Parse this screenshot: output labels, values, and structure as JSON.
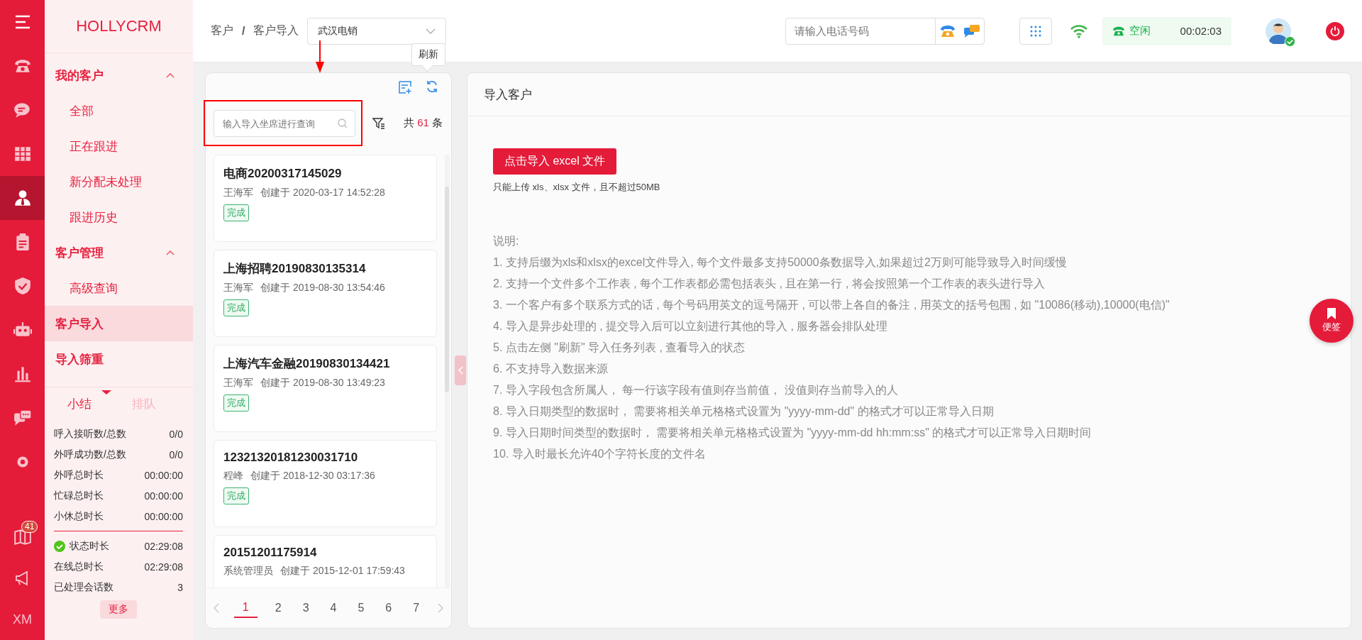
{
  "rail": {
    "items": [
      {
        "selected": false
      },
      {
        "selected": false
      },
      {
        "selected": false
      },
      {
        "selected": true
      },
      {
        "selected": false
      },
      {
        "selected": false
      },
      {
        "selected": false
      },
      {
        "selected": false
      },
      {
        "selected": false
      },
      {
        "selected": false
      }
    ],
    "book_badge": "41",
    "user_initials": "XM"
  },
  "sidebar": {
    "logo": "HOLLYCRM",
    "items": [
      {
        "label": "我的客户",
        "expanded": true,
        "children": [
          {
            "label": "全部",
            "selected": false
          },
          {
            "label": "正在跟进",
            "selected": false
          },
          {
            "label": "新分配未处理",
            "selected": false
          },
          {
            "label": "跟进历史",
            "selected": false
          }
        ]
      },
      {
        "label": "客户管理",
        "expanded": true,
        "children": [
          {
            "label": "高级查询",
            "selected": false
          }
        ]
      },
      {
        "label": "客户导入",
        "selected": true
      },
      {
        "label": "导入筛重",
        "selected": false
      }
    ],
    "summary": {
      "tabs": [
        {
          "label": "小结",
          "selected": true
        },
        {
          "label": "排队",
          "selected": false
        }
      ],
      "rows": [
        {
          "label": "呼入接听数/总数",
          "value": "0/0"
        },
        {
          "label": "外呼成功数/总数",
          "value": "0/0"
        },
        {
          "label": "外呼总时长",
          "value": "00:00:00"
        },
        {
          "label": "忙碌总时长",
          "value": "00:00:00"
        },
        {
          "label": "小休总时长",
          "value": "00:00:00"
        }
      ],
      "rows2": [
        {
          "label": "状态时长",
          "value": "02:29:08",
          "ok": true
        },
        {
          "label": "在线总时长",
          "value": "02:29:08",
          "ok": false
        },
        {
          "label": "已处理会话数",
          "value": "3",
          "ok": false
        }
      ],
      "more": "更多"
    }
  },
  "header": {
    "breadcrumb": [
      "客户",
      "客户导入"
    ],
    "separator": "/",
    "dropdown": "武汉电销",
    "phone_placeholder": "请输入电话号码",
    "status": "空闲",
    "timer": "00:02:03",
    "online": true
  },
  "tooltip": "刷新",
  "list": {
    "search_placeholder": "输入导入坐席进行查询",
    "count_prefix": "共",
    "count": "61",
    "count_suffix": "条",
    "cards": [
      {
        "title": "电商20200317145029",
        "owner": "王海军",
        "created": "创建于 2020-03-17 14:52:28",
        "status": "完成"
      },
      {
        "title": "上海招聘20190830135314",
        "owner": "王海军",
        "created": "创建于 2019-08-30 13:54:46",
        "status": "完成"
      },
      {
        "title": "上海汽车金融20190830134421",
        "owner": "王海军",
        "created": "创建于 2019-08-30 13:49:23",
        "status": "完成"
      },
      {
        "title": "12321320181230031710",
        "owner": "程峰",
        "created": "创建于 2018-12-30 03:17:36",
        "status": "完成"
      },
      {
        "title": "20151201175914",
        "owner": "系统管理员",
        "created": "创建于 2015-12-01 17:59:43"
      }
    ],
    "pages": [
      {
        "label": "1",
        "selected": true
      },
      {
        "label": "2",
        "selected": false
      },
      {
        "label": "3",
        "selected": false
      },
      {
        "label": "4",
        "selected": false
      },
      {
        "label": "5",
        "selected": false
      },
      {
        "label": "6",
        "selected": false
      },
      {
        "label": "7",
        "selected": false
      }
    ]
  },
  "main": {
    "title": "导入客户",
    "button": "点击导入 excel 文件",
    "hint": "只能上传 xls、xlsx 文件，且不超过50MB",
    "notes_title": "说明:",
    "notes": [
      "1. 支持后缀为xls和xlsx的excel文件导入, 每个文件最多支持50000条数据导入,如果超过2万则可能导致导入时间缓慢",
      "2. 支持一个文件多个工作表 , 每个工作表都必需包括表头 , 且在第一行 , 将会按照第一个工作表的表头进行导入",
      "3. 一个客户有多个联系方式的话 , 每个号码用英文的逗号隔开 , 可以带上各自的备注 , 用英文的括号包围 , 如 \"10086(移动),10000(电信)\"",
      "4. 导入是异步处理的 , 提交导入后可以立刻进行其他的导入 , 服务器会排队处理",
      "5. 点击左侧 \"刷新\" 导入任务列表 , 查看导入的状态",
      "6. 不支持导入数据来源",
      "7. 导入字段包含所属人， 每一行该字段有值则存当前值， 没值则存当前导入的人",
      "8. 导入日期类型的数据时， 需要将相关单元格格式设置为 \"yyyy-mm-dd\" 的格式才可以正常导入日期",
      "9. 导入日期时间类型的数据时， 需要将相关单元格格式设置为 \"yyyy-mm-dd hh:mm:ss\" 的格式才可以正常导入日期时间",
      "10. 导入时最长允许40个字符长度的文件名"
    ]
  },
  "note_button": "便签"
}
